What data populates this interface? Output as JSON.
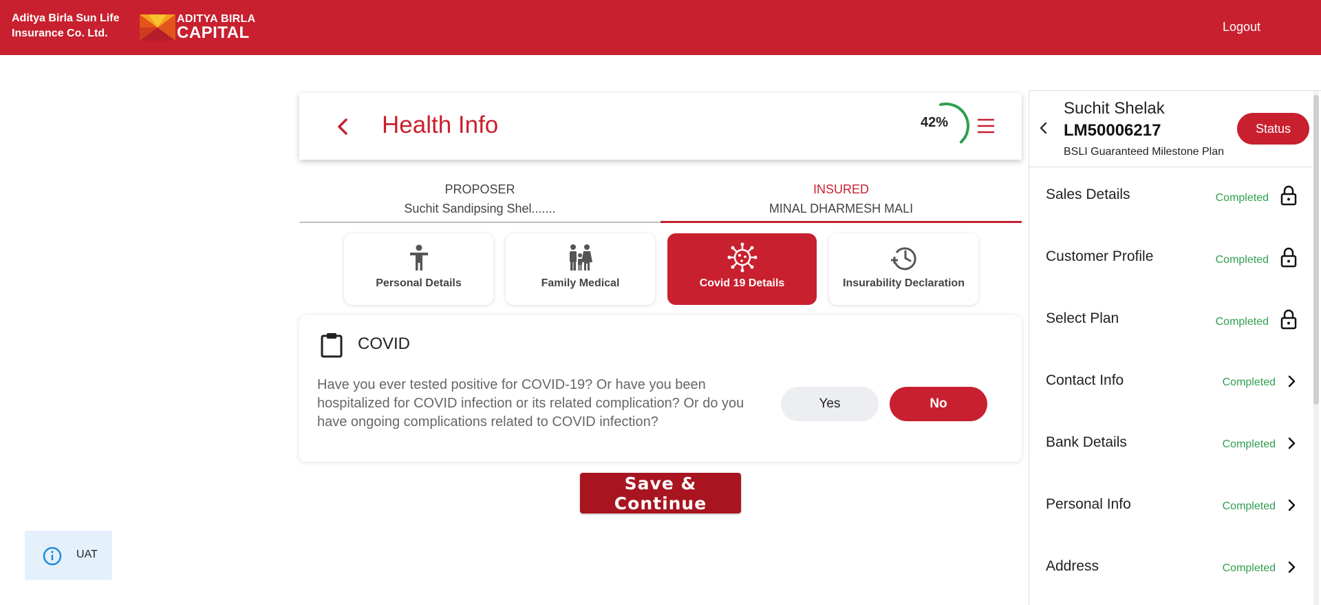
{
  "header": {
    "company_line1": "Aditya Birla Sun Life",
    "company_line2": "Insurance Co. Ltd.",
    "logo_line1": "ADITYA BIRLA",
    "logo_line2": "CAPITAL",
    "logout_label": "Logout",
    "brand_color": "#c8202f"
  },
  "main": {
    "title": "Health Info",
    "progress_label": "42%",
    "progress_value": 0.42,
    "tabs": [
      {
        "label": "PROPOSER",
        "sub": "Suchit Sandipsing Shel.......",
        "active": false
      },
      {
        "label": "INSURED",
        "sub": "MINAL DHARMESH MALI",
        "active": true
      }
    ],
    "sections": [
      {
        "label": "Personal Details",
        "icon": "person-icon",
        "active": false
      },
      {
        "label": "Family Medical",
        "icon": "family-icon",
        "active": false
      },
      {
        "label": "Covid 19 Details",
        "icon": "virus-icon",
        "active": true
      },
      {
        "label": "Insurability Declaration",
        "icon": "history-icon",
        "active": false
      }
    ],
    "covid": {
      "title": "COVID",
      "question": "Have you ever tested positive for COVID-19? Or have you been hospitalized for COVID infection or its related complication? Or do you have ongoing complications related to COVID infection?",
      "yes_label": "Yes",
      "no_label": "No",
      "selected": "No"
    },
    "save_label": "Save & Continue"
  },
  "env_badge": {
    "label": "UAT",
    "icon": "info-icon"
  },
  "panel": {
    "customer_name": "Suchit Shelak",
    "customer_id": "LM50006217",
    "plan": "BSLI Guaranteed Milestone Plan",
    "status_label": "Status",
    "steps": [
      {
        "label": "Sales Details",
        "status": "Completed",
        "icon": "lock-icon"
      },
      {
        "label": "Customer Profile",
        "status": "Completed",
        "icon": "lock-icon"
      },
      {
        "label": "Select Plan",
        "status": "Completed",
        "icon": "lock-icon"
      },
      {
        "label": "Contact Info",
        "status": "Completed",
        "icon": "chevron-right-icon"
      },
      {
        "label": "Bank Details",
        "status": "Completed",
        "icon": "chevron-right-icon"
      },
      {
        "label": "Personal Info",
        "status": "Completed",
        "icon": "chevron-right-icon"
      },
      {
        "label": "Address",
        "status": "Completed",
        "icon": "chevron-right-icon"
      }
    ]
  }
}
